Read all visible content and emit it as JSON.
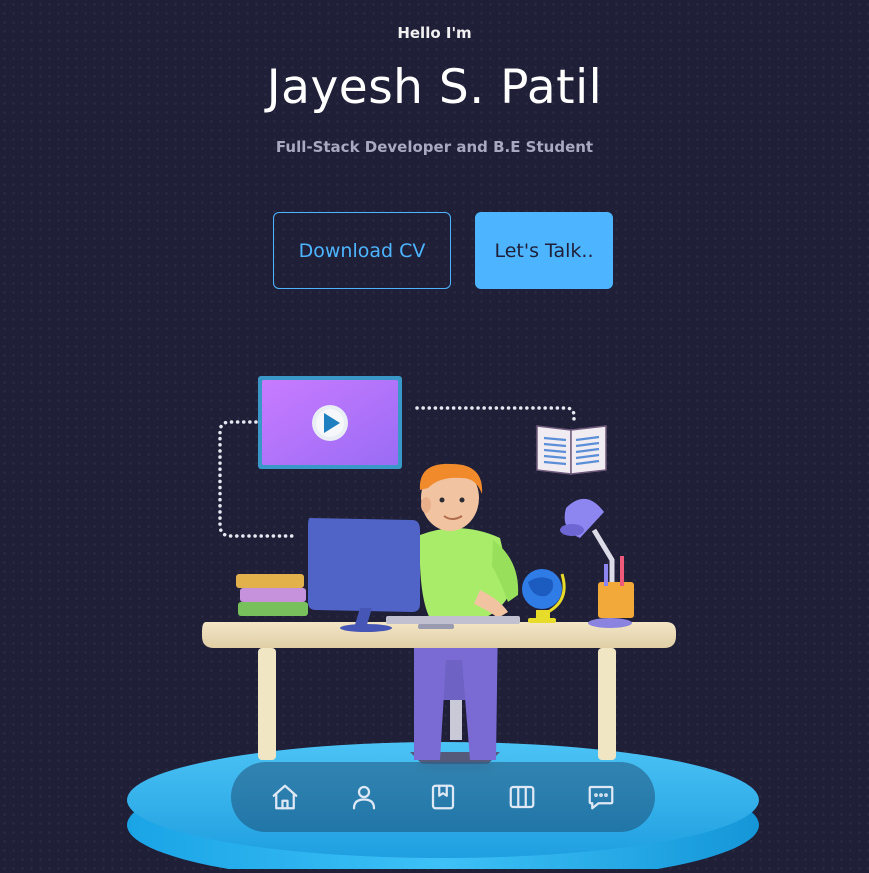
{
  "header": {
    "greeting": "Hello I'm",
    "name": "Jayesh S. Patil",
    "role": "Full-Stack Developer and B.E Student"
  },
  "cta": {
    "download_label": "Download CV",
    "talk_label": "Let's Talk.."
  },
  "illustration": {
    "alt": "3D developer at desk illustration"
  },
  "nav": {
    "items": [
      {
        "icon": "home-icon"
      },
      {
        "icon": "user-icon"
      },
      {
        "icon": "book-icon"
      },
      {
        "icon": "columns-icon"
      },
      {
        "icon": "chat-icon"
      }
    ]
  },
  "colors": {
    "background": "#1f1f38",
    "accent": "#4db5ff",
    "text_light": "#a9a9c2"
  }
}
